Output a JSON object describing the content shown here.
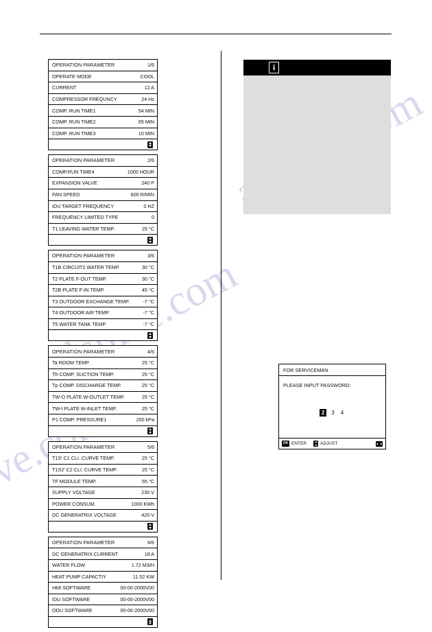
{
  "document": {
    "watermark_text": "alshive.com"
  },
  "left_column": {
    "tables": [
      {
        "name": "operation-parameter-page-1",
        "header": {
          "label": "OPERATION PARAMETER",
          "value": "1/6"
        },
        "rows": [
          {
            "label": "OPERATE MODE",
            "value": "COOL"
          },
          {
            "label": "CURRENT",
            "value": "12 A"
          },
          {
            "label": "COMPRESSOR  FREQUNCY",
            "value": "24  Hz"
          },
          {
            "label": "COMP. RUN TIME1",
            "value": "54  MIN"
          },
          {
            "label": "COMP. RUN TIME2",
            "value": "65  MIN"
          },
          {
            "label": "COMP. RUN TIME3",
            "value": "10  MIN"
          }
        ],
        "footer_icon": "up-down-arrows-icon"
      },
      {
        "name": "operation-parameter-page-2",
        "header": {
          "label": "OPERATION PARAMETER",
          "value": "2/6"
        },
        "rows": [
          {
            "label": "COMP.RUN  TIME4",
            "value": "1000  HOUR"
          },
          {
            "label": "EXPANSION  VALVE",
            "value": "240  P"
          },
          {
            "label": "FAN  SPEED",
            "value": "600  R/MIN"
          },
          {
            "label": "IDU TARGET FREQUENCY",
            "value": "0  HZ"
          },
          {
            "label": "FREQUENCY LIMITED TYPE",
            "value": "0"
          },
          {
            "label": "T1  LEAVING  WATER TEMP.",
            "value": "25  °C"
          }
        ],
        "footer_icon": "up-down-arrows-icon"
      },
      {
        "name": "operation-parameter-page-3",
        "header": {
          "label": "OPERATION PARAMETER",
          "value": "3/6"
        },
        "rows": [
          {
            "label": "T1B CIRCUIT2 WATER TEMP.",
            "value": "30  °C"
          },
          {
            "label": "T2     PLATE  F-OUT  TEMP.",
            "value": "30  °C"
          },
          {
            "label": "T2B   PLATE  F-IN  TEMP.",
            "value": "45  °C"
          },
          {
            "label": "T3   OUTDOOR EXCHANGE TEMP.",
            "value": "-7  °C"
          },
          {
            "label": "T4   OUTDOOR AIR TEMP.",
            "value": "-7  °C"
          },
          {
            "label": "T5   WATER TANK TEMP.",
            "value": "-7  °C"
          }
        ],
        "footer_icon": "up-down-arrows-icon"
      },
      {
        "name": "operation-parameter-page-4",
        "header": {
          "label": "OPERATION PARAMETER",
          "value": "4/6"
        },
        "rows": [
          {
            "label": "Ta ROOM TEMP.",
            "value": "25  °C"
          },
          {
            "label": "Th COMP. SUCTION TEMP.",
            "value": "25  °C"
          },
          {
            "label": "Tp COMP. DISCHARGE TEMP.",
            "value": "25  °C"
          },
          {
            "label": "TW-O  PLATE W-OUTLET TEMP.",
            "value": "25  °C"
          },
          {
            "label": "TW-I  PLATE W-INLET  TEMP.",
            "value": "25  °C"
          },
          {
            "label": "P1  COMP. PRESSURE1",
            "value": "200  kPa"
          }
        ],
        "footer_icon": "up-down-arrows-icon"
      },
      {
        "name": "operation-parameter-page-5",
        "header": {
          "label": "OPERATION PARAMETER",
          "value": "5/6"
        },
        "rows": [
          {
            "label": "T1S' C1 CLI. CURVE TEMP.",
            "value": "25  °C"
          },
          {
            "label": "T1S2' C2 CLI. CURVE TEMP.",
            "value": "25  °C"
          },
          {
            "label": "TF MODULE TEMP.",
            "value": "55  °C"
          },
          {
            "label": "SUPPLY VOLTAGE",
            "value": "230  V"
          },
          {
            "label": "POWER CONSUM.",
            "value": "1000  KWh"
          },
          {
            "label": "DC GENERATRIX VOLTAGE",
            "value": "420  V"
          }
        ],
        "footer_icon": "up-down-arrows-icon"
      },
      {
        "name": "operation-parameter-page-6",
        "header": {
          "label": "OPERATION PARAMETER",
          "value": "6/6"
        },
        "rows": [
          {
            "label": "DC GENERATRIX CURRENT",
            "value": "18  A"
          },
          {
            "label": "WATER FLOW",
            "value": "1.72  M3/H"
          },
          {
            "label": "HEAT PUMP CAPACTIY",
            "value": "11.52  KW"
          },
          {
            "label": "HMI SOFTWARE",
            "value": "00-00-2000V00"
          },
          {
            "label": "IDU SOFTWARE",
            "value": "00-00-2000V00"
          },
          {
            "label": "ODU SOFTWARE",
            "value": "00-00-2000V00"
          }
        ],
        "footer_icon": "up-down-arrows-icon"
      }
    ]
  },
  "right_column": {
    "info_screen": {
      "name": "information-screen",
      "icon": "info-i-icon",
      "icon_glyph": "i",
      "titlebar_color": "#000000",
      "body_color": "#dedede"
    },
    "serviceman_screen": {
      "title": "FOR SERVICEMAN",
      "prompt": "PLEASE INPUT PASSWORD:",
      "digits": [
        {
          "value": "2",
          "selected": true
        },
        {
          "value": "3",
          "selected": false
        },
        {
          "value": "4",
          "selected": false
        }
      ],
      "footer": {
        "ok_icon_label": "OK",
        "enter_label": "ENTER",
        "adjust_icon": "up-down-arrows-icon",
        "adjust_label": "ADJUST",
        "navigate_icon": "left-right-arrows-icon"
      }
    }
  }
}
